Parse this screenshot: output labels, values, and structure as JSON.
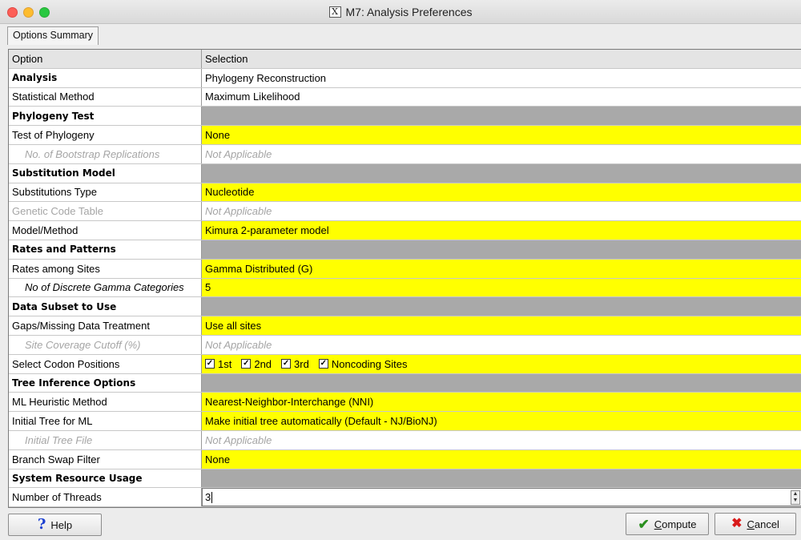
{
  "window": {
    "title": "M7: Analysis Preferences"
  },
  "tabs": [
    {
      "label": "Options Summary"
    }
  ],
  "table": {
    "headers": {
      "option": "Option",
      "selection": "Selection"
    },
    "rows": [
      {
        "option": "Analysis",
        "selection": "Phylogeny Reconstruction",
        "kind": "bold"
      },
      {
        "option": "Statistical Method",
        "selection": "Maximum Likelihood",
        "kind": "plain"
      },
      {
        "option": "Phylogeny Test",
        "selection": "",
        "kind": "section"
      },
      {
        "option": "Test of Phylogeny",
        "selection": "None",
        "kind": "editable"
      },
      {
        "option": "No. of Bootstrap Replications",
        "selection": "Not Applicable",
        "kind": "disabled"
      },
      {
        "option": "Substitution Model",
        "selection": "",
        "kind": "section"
      },
      {
        "option": "Substitutions Type",
        "selection": "Nucleotide",
        "kind": "editable"
      },
      {
        "option": "Genetic Code Table",
        "selection": "Not Applicable",
        "kind": "disabled-plain"
      },
      {
        "option": "Model/Method",
        "selection": "Kimura 2-parameter model",
        "kind": "editable"
      },
      {
        "option": "Rates and Patterns",
        "selection": "",
        "kind": "section"
      },
      {
        "option": "Rates among Sites",
        "selection": "Gamma Distributed (G)",
        "kind": "editable"
      },
      {
        "option": "No of Discrete Gamma Categories",
        "selection": "5",
        "kind": "editable-sub"
      },
      {
        "option": "Data Subset to Use",
        "selection": "",
        "kind": "section"
      },
      {
        "option": "Gaps/Missing Data Treatment",
        "selection": "Use all sites",
        "kind": "editable"
      },
      {
        "option": "Site Coverage Cutoff (%)",
        "selection": "Not Applicable",
        "kind": "disabled"
      },
      {
        "option": "Select Codon Positions",
        "selection": "",
        "kind": "codons"
      },
      {
        "option": "Tree Inference Options",
        "selection": "",
        "kind": "section"
      },
      {
        "option": "ML Heuristic Method",
        "selection": "Nearest-Neighbor-Interchange (NNI)",
        "kind": "editable"
      },
      {
        "option": "Initial Tree for ML",
        "selection": "Make initial tree automatically (Default - NJ/BioNJ)",
        "kind": "editable"
      },
      {
        "option": "Initial Tree File",
        "selection": "Not Applicable",
        "kind": "disabled"
      },
      {
        "option": "Branch Swap Filter",
        "selection": "None",
        "kind": "editable"
      },
      {
        "option": "System Resource Usage",
        "selection": "",
        "kind": "section"
      },
      {
        "option": "Number of Threads",
        "selection": "3",
        "kind": "numeric"
      }
    ]
  },
  "codon_positions": [
    {
      "label": "1st",
      "checked": true
    },
    {
      "label": "2nd",
      "checked": true
    },
    {
      "label": "3rd",
      "checked": true
    },
    {
      "label": "Noncoding Sites",
      "checked": true
    }
  ],
  "buttons": {
    "help": "Help",
    "compute": "Compute",
    "cancel": "Cancel"
  },
  "icons": {
    "help": "question-mark-icon",
    "compute": "checkmark-icon",
    "cancel": "red-x-icon"
  },
  "colors": {
    "editable_bg": "#ffff00",
    "section_bg": "#a9a9a9"
  }
}
